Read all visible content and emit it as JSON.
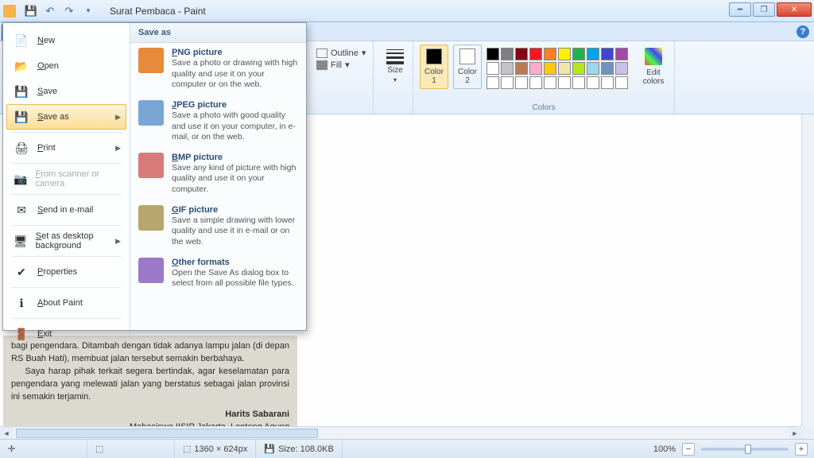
{
  "title": "Surat Pembaca - Paint",
  "ribbon": {
    "outline": "Outline",
    "fill": "Fill",
    "size": "Size",
    "color1": "Color\n1",
    "color2": "Color\n2",
    "edit_colors": "Edit\ncolors",
    "group_colors": "Colors"
  },
  "palette_top": [
    "#000000",
    "#7f7f7f",
    "#880015",
    "#ed1c24",
    "#ff7f27",
    "#fff200",
    "#22b14c",
    "#00a2e8",
    "#3f48cc",
    "#a349a4"
  ],
  "palette_bot": [
    "#ffffff",
    "#c3c3c3",
    "#b97a57",
    "#ffaec9",
    "#ffc90e",
    "#efe4b0",
    "#b5e61d",
    "#99d9ea",
    "#7092be",
    "#c8bfe7"
  ],
  "file_menu": {
    "items": [
      {
        "key": "new",
        "label": "New",
        "ico": "📄"
      },
      {
        "key": "open",
        "label": "Open",
        "ico": "📂"
      },
      {
        "key": "save",
        "label": "Save",
        "ico": "💾"
      },
      {
        "key": "saveas",
        "label": "Save as",
        "ico": "💾",
        "arrow": true,
        "hover": true
      },
      {
        "sep": true
      },
      {
        "key": "print",
        "label": "Print",
        "ico": "🖨",
        "arrow": true
      },
      {
        "sep": true
      },
      {
        "key": "scanner",
        "label": "From scanner or camera",
        "ico": "📷",
        "disabled": true
      },
      {
        "sep": true
      },
      {
        "key": "email",
        "label": "Send in e-mail",
        "ico": "✉"
      },
      {
        "sep": true
      },
      {
        "key": "desktop",
        "label": "Set as desktop background",
        "ico": "🖥",
        "arrow": true
      },
      {
        "sep": true
      },
      {
        "key": "props",
        "label": "Properties",
        "ico": "✔"
      },
      {
        "sep": true
      },
      {
        "key": "about",
        "label": "About Paint",
        "ico": "ℹ"
      },
      {
        "sep": true
      },
      {
        "key": "exit",
        "label": "Exit",
        "ico": "🚪"
      }
    ],
    "submenu_head": "Save as",
    "formats": [
      {
        "cls": "fmt-png",
        "t": "PNG picture",
        "d": "Save a photo or drawing with high quality and use it on your computer or on the web."
      },
      {
        "cls": "fmt-jpg",
        "t": "JPEG picture",
        "d": "Save a photo with good quality and use it on your computer, in e-mail, or on the web."
      },
      {
        "cls": "fmt-bmp",
        "t": "BMP picture",
        "d": "Save any kind of picture with high quality and use it on your computer."
      },
      {
        "cls": "fmt-gif",
        "t": "GIF picture",
        "d": "Save a simple drawing with lower quality and use it in e-mail or on the web."
      },
      {
        "cls": "fmt-oth",
        "t": "Other formats",
        "d": "Open the Save As dialog box to select from all possible file types."
      }
    ]
  },
  "doc_text": {
    "p1": "bagi pengendara. Ditambah dengan tidak adanya lampu jalan (di depan RS Buah Hati), membuat jalan tersebut semakin berbahaya.",
    "p2": "Saya harap pihak terkait segera bertindak, agar keselamatan para pengendara yang melewati jalan yang berstatus sebagai jalan provinsi ini semakin terjamin.",
    "sig1": "Harits Sabarani",
    "sig2": "Mahasiswa IISIP Jakarta, Lenteng Agung"
  },
  "status": {
    "dims": "1360 × 624px",
    "size": "Size: 108.0KB",
    "zoom": "100%"
  }
}
